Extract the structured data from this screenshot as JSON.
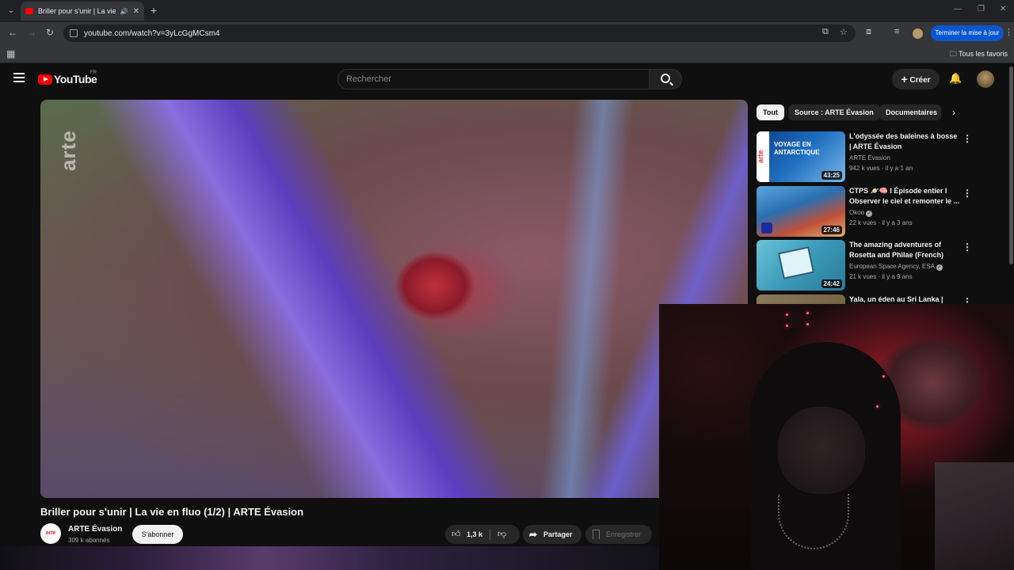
{
  "browser": {
    "tab_title": "Briller pour s'unir | La vie en fl",
    "url": "youtube.com/watch?v=3yLcGgMCsm4",
    "update_button": "Terminer la mise à jour",
    "bookmarks_all": "Tous les favoris"
  },
  "masthead": {
    "logo_text": "YouTube",
    "country_code": "FR",
    "search_placeholder": "Rechercher",
    "create_label": "Créer"
  },
  "player": {
    "watermark": "arte"
  },
  "video": {
    "title": "Briller pour s'unir | La vie en fluo (1/2) | ARTE Évasion",
    "channel_logo": "arte",
    "channel_name": "ARTE Évasion",
    "subscribers": "309 k abonnés",
    "subscribe_label": "S'abonner",
    "likes": "1,3 k",
    "share_label": "Partager",
    "save_label": "Enregistrer"
  },
  "chips": [
    {
      "label": "Tout",
      "active": true
    },
    {
      "label": "Source : ARTE Évasion",
      "active": false
    },
    {
      "label": "Documentaires",
      "active": false
    }
  ],
  "recommendations": [
    {
      "title": "L'odyssée des baleines à bosse | ARTE Évasion",
      "channel": "ARTE Évasion",
      "meta": "942 k vues · il y a 1 an",
      "duration": "43:25",
      "thumb_text": "VOYAGE EN ANTARCTIQUE",
      "thumb_brand": "arte"
    },
    {
      "title": "CTPS 🪐🧠 I Épisode entier I Observer le ciel et remonter le ...",
      "channel": "Okoo",
      "meta": "22 k vues · il y a 3 ans",
      "duration": "27:46"
    },
    {
      "title": "The amazing adventures of Rosetta and Philae (French)",
      "channel": "European Space Agency, ESA",
      "meta": "21 k vues · il y a 9 ans",
      "duration": "24:42"
    },
    {
      "title": "Yala, un éden au Sri Lanka |",
      "channel": "",
      "meta": "",
      "duration": ""
    }
  ],
  "colors": {
    "youtube_red": "#ff0000",
    "background": "#0f0f0f",
    "chip_bg": "#272727",
    "update_blue": "#0b57d0"
  }
}
